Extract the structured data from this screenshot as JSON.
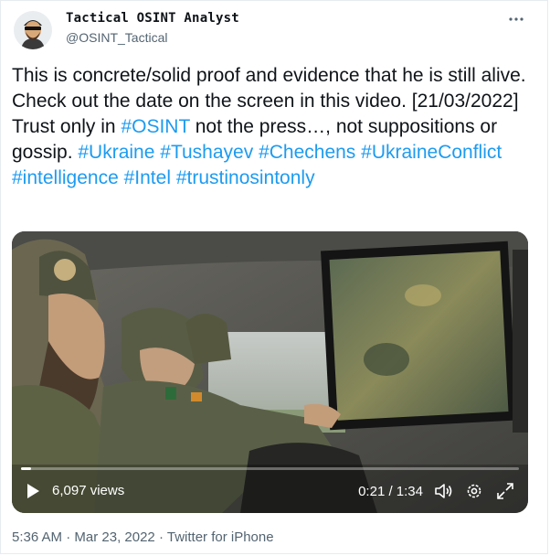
{
  "author": {
    "name": "Tactical OSINT Analyst",
    "handle": "@OSINT_Tactical"
  },
  "tweet": {
    "segments": [
      {
        "text": "This is concrete/solid proof and evidence that he is still alive. Check out the date on the screen in this video. [21/03/2022] Trust only in ",
        "tag": false
      },
      {
        "text": "#OSINT",
        "tag": true
      },
      {
        "text": " not the press…, not suppositions or gossip. ",
        "tag": false
      },
      {
        "text": "#Ukraine",
        "tag": true
      },
      {
        "text": " ",
        "tag": false
      },
      {
        "text": "#Tushayev",
        "tag": true
      },
      {
        "text": " ",
        "tag": false
      },
      {
        "text": "#Chechens",
        "tag": true
      },
      {
        "text": " ",
        "tag": false
      },
      {
        "text": "#UkraineConflict",
        "tag": true
      },
      {
        "text": " ",
        "tag": false
      },
      {
        "text": "#intelligence",
        "tag": true
      },
      {
        "text": " ",
        "tag": false
      },
      {
        "text": "#Intel",
        "tag": true
      },
      {
        "text": " ",
        "tag": false
      },
      {
        "text": "#trustinosintonly",
        "tag": true
      }
    ]
  },
  "video": {
    "views": "6,097 views",
    "time": "0:21 / 1:34",
    "progress": 0.02
  },
  "meta": {
    "time": "5:36 AM",
    "sep1": "·",
    "date": "Mar 23, 2022",
    "sep2": "·",
    "source": "Twitter for iPhone"
  },
  "colors": {
    "link": "#1d9bf0",
    "secondary": "#536471"
  },
  "icons": [
    "more-icon",
    "play-icon",
    "volume-icon",
    "settings-icon",
    "fullscreen-icon"
  ]
}
